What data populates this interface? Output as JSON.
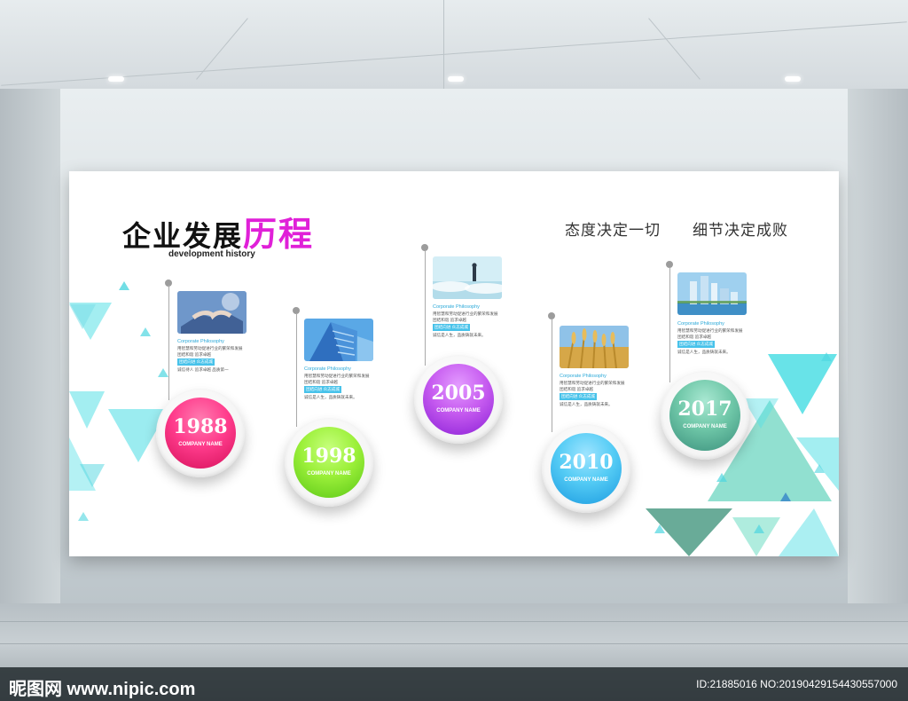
{
  "board": {
    "title_main": "企业发展",
    "title_accent": "历程",
    "subtitle": "development history",
    "slogans": [
      "态度决定一切",
      "细节决定成败"
    ]
  },
  "milestones": [
    {
      "year": "1988",
      "company": "COMPANY NAME",
      "color_a": "#ff3c8c",
      "color_b": "#d5105a",
      "card": {
        "head": "Corporate Philosophy",
        "line1": "用智慧和劳动促进行业的繁荣和发展",
        "line2": "团结和谐  追求卓越",
        "tag": "团结向进  众志成城",
        "line3": "诚信待人 追求卓越 品质第一",
        "line4": "诚信是人生，品质铸就未来。"
      }
    },
    {
      "year": "1998",
      "company": "COMPANY NAME",
      "color_a": "#9cf03a",
      "color_b": "#5ac716",
      "card": {
        "head": "Corporate Philosophy",
        "line1": "用智慧和劳动促进行业的繁荣和发展",
        "line2": "团结和谐  追求卓越",
        "tag": "团结向进  众志成城",
        "line3": "诚信待人 追求卓越 品质第一",
        "line4": "诚信是人生，品质铸就未来。"
      }
    },
    {
      "year": "2005",
      "company": "COMPANY NAME",
      "color_a": "#c75cf0",
      "color_b": "#8a1fd6",
      "card": {
        "head": "Corporate Philosophy",
        "line1": "用智慧和劳动促进行业的繁荣和发展",
        "line2": "团结和谐  追求卓越",
        "tag": "团结向进  众志成城",
        "line3": "诚信待人 追求卓越 品质第一",
        "line4": "诚信是人生，品质铸就未来。"
      }
    },
    {
      "year": "2010",
      "company": "COMPANY NAME",
      "color_a": "#55ccf5",
      "color_b": "#1a9ae0",
      "card": {
        "head": "Corporate Philosophy",
        "line1": "用智慧和劳动促进行业的繁荣和发展",
        "line2": "团结和谐  追求卓越",
        "tag": "团结向进  众志成城",
        "line3": "诚信待人 追求卓越 品质第一",
        "line4": "诚信是人生，品质铸就未来。"
      }
    },
    {
      "year": "2017",
      "company": "COMPANY NAME",
      "color_a": "#6fc7a8",
      "color_b": "#3a8f7c",
      "card": {
        "head": "Corporate Philosophy",
        "line1": "用智慧和劳动促进行业的繁荣和发展",
        "line2": "团结和谐  追求卓越",
        "tag": "团结向进  众志成城",
        "line3": "诚信待人 追求卓越 品质第一",
        "line4": "诚信是人生，品质铸就未来。"
      }
    }
  ],
  "watermark": {
    "left": "昵图网 www.nipic.com",
    "right": "ID:21885016 NO:20190429154430557000"
  },
  "palette": {
    "cyan": "#58e0e6",
    "teal": "#4f9c86",
    "blue": "#47c2ea",
    "magenta": "#e020d8"
  }
}
